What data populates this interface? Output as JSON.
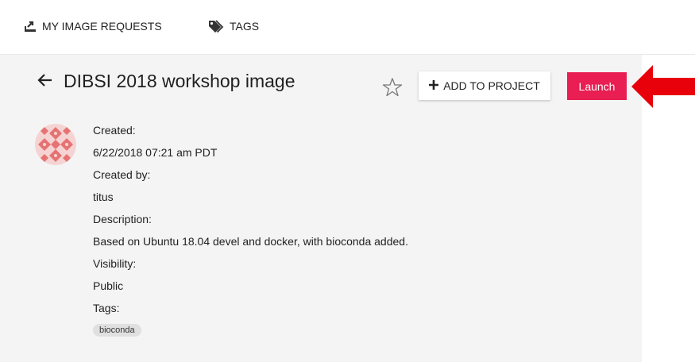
{
  "nav": {
    "image_requests_label": "MY IMAGE REQUESTS",
    "tags_label": "TAGS",
    "image_requests_icon": "upload-tray-icon",
    "tags_icon": "tags-icon"
  },
  "image": {
    "title": "DIBSI 2018 workshop image",
    "created_label": "Created:",
    "created_value": "6/22/2018 07:21 am PDT",
    "created_by_label": "Created by:",
    "created_by_value": "titus",
    "description_label": "Description:",
    "description_value": "Based on Ubuntu 18.04 devel and docker, with bioconda added.",
    "visibility_label": "Visibility:",
    "visibility_value": "Public",
    "tags_label": "Tags:",
    "tags": [
      "bioconda"
    ]
  },
  "actions": {
    "add_to_project_label": "ADD TO PROJECT",
    "launch_label": "Launch"
  },
  "colors": {
    "launch_button": "#e91e52",
    "annotation_arrow": "#e8000b",
    "panel_background": "#f4f4f4",
    "avatar_pattern": "#e57373"
  }
}
